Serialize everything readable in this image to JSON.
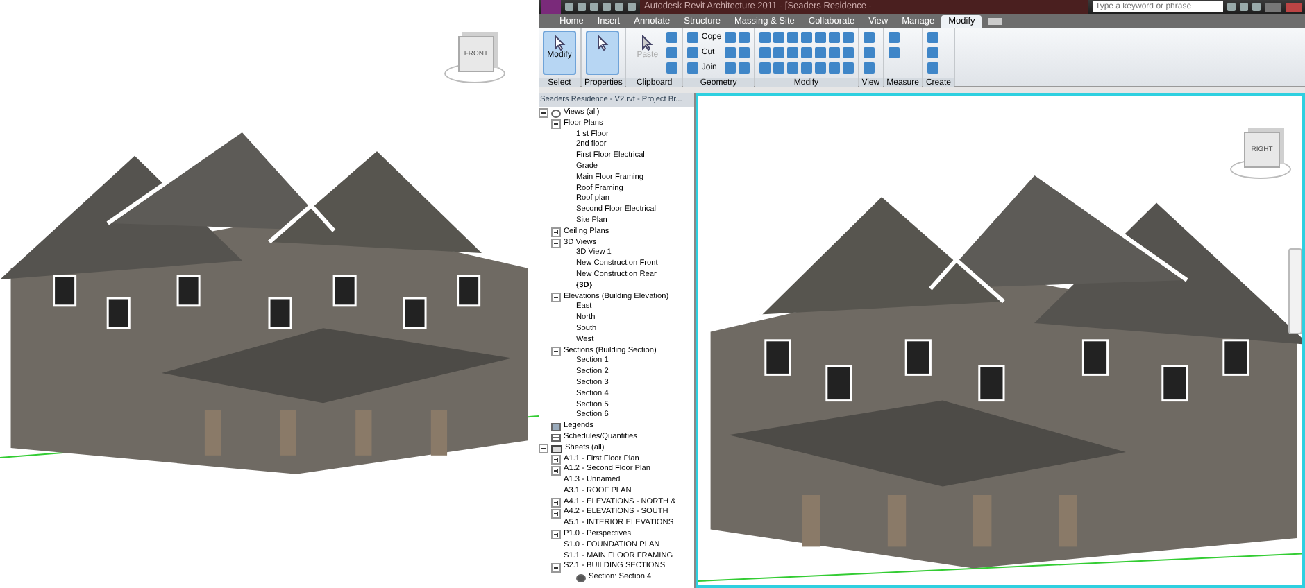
{
  "left_view": {
    "view_cube": {
      "face": "FRONT"
    }
  },
  "title_bar": {
    "title": "Autodesk Revit Architecture 2011 - [Seaders Residence -",
    "search": {
      "placeholder": "Type a keyword or phrase"
    }
  },
  "ribbon": {
    "tabs": [
      {
        "label": "Home",
        "selected": false
      },
      {
        "label": "Insert",
        "selected": false
      },
      {
        "label": "Annotate",
        "selected": false
      },
      {
        "label": "Structure",
        "selected": false
      },
      {
        "label": "Massing & Site",
        "selected": false
      },
      {
        "label": "Collaborate",
        "selected": false
      },
      {
        "label": "View",
        "selected": false
      },
      {
        "label": "Manage",
        "selected": false
      },
      {
        "label": "Modify",
        "selected": true
      }
    ],
    "panels": [
      {
        "label": "Select",
        "tools": [
          {
            "kind": "large",
            "label": "Modify",
            "active": true,
            "disabled": false
          }
        ]
      },
      {
        "label": "Properties",
        "tools": [
          {
            "kind": "large",
            "active": true,
            "disabled": false
          }
        ]
      },
      {
        "label": "Clipboard",
        "tools": [
          {
            "kind": "large",
            "label": "Paste",
            "active": false,
            "disabled": true
          },
          {
            "kind": "icon"
          },
          {
            "kind": "icon"
          },
          {
            "kind": "icon"
          }
        ]
      },
      {
        "label": "Geometry",
        "tools": [
          {
            "kind": "small",
            "label": "Cope"
          },
          {
            "kind": "small",
            "label": "Cut"
          },
          {
            "kind": "small",
            "label": "Join"
          },
          {
            "kind": "icon"
          },
          {
            "kind": "icon"
          },
          {
            "kind": "icon"
          },
          {
            "kind": "icon"
          },
          {
            "kind": "icon"
          },
          {
            "kind": "icon"
          }
        ]
      },
      {
        "label": "Modify",
        "tools": [
          {
            "kind": "icon"
          },
          {
            "kind": "icon"
          },
          {
            "kind": "icon"
          },
          {
            "kind": "icon"
          },
          {
            "kind": "icon"
          },
          {
            "kind": "icon"
          },
          {
            "kind": "icon"
          },
          {
            "kind": "icon"
          },
          {
            "kind": "icon"
          },
          {
            "kind": "icon"
          },
          {
            "kind": "icon"
          },
          {
            "kind": "icon"
          },
          {
            "kind": "icon"
          },
          {
            "kind": "icon"
          },
          {
            "kind": "icon"
          },
          {
            "kind": "icon"
          },
          {
            "kind": "icon"
          },
          {
            "kind": "icon"
          },
          {
            "kind": "icon"
          },
          {
            "kind": "icon"
          },
          {
            "kind": "icon"
          }
        ]
      },
      {
        "label": "View",
        "tools": [
          {
            "kind": "icon"
          },
          {
            "kind": "icon"
          },
          {
            "kind": "icon"
          }
        ]
      },
      {
        "label": "Measure",
        "tools": [
          {
            "kind": "icon"
          },
          {
            "kind": "icon"
          }
        ]
      },
      {
        "label": "Create",
        "tools": [
          {
            "kind": "icon"
          },
          {
            "kind": "icon"
          },
          {
            "kind": "icon"
          }
        ]
      }
    ]
  },
  "project_browser": {
    "title": "Seaders Residence - V2.rvt - Project Br...",
    "items": [
      {
        "label": "Views (all)",
        "kind": "views",
        "expanded": true,
        "selected": false,
        "children": [
          {
            "label": "Floor Plans",
            "expanded": true,
            "selected": false,
            "children": [
              {
                "label": "1 st Floor",
                "selected": false
              },
              {
                "label": "2nd floor",
                "selected": false
              },
              {
                "label": "First Floor Electrical",
                "selected": false
              },
              {
                "label": "Grade",
                "selected": false
              },
              {
                "label": "Main Floor Framing",
                "selected": false
              },
              {
                "label": "Roof Framing",
                "selected": false
              },
              {
                "label": "Roof plan",
                "selected": false
              },
              {
                "label": "Second Floor Electrical",
                "selected": false
              },
              {
                "label": "Site Plan",
                "selected": false
              }
            ]
          },
          {
            "label": "Ceiling Plans",
            "expanded": false,
            "selected": false
          },
          {
            "label": "3D Views",
            "expanded": true,
            "selected": false,
            "children": [
              {
                "label": "3D View 1",
                "selected": false
              },
              {
                "label": "New Construction Front",
                "selected": false
              },
              {
                "label": "New Construction Rear",
                "selected": false
              },
              {
                "label": "{3D}",
                "selected": true
              }
            ]
          },
          {
            "label": "Elevations (Building Elevation)",
            "expanded": true,
            "selected": false,
            "children": [
              {
                "label": "East",
                "selected": false
              },
              {
                "label": "North",
                "selected": false
              },
              {
                "label": "South",
                "selected": false
              },
              {
                "label": "West",
                "selected": false
              }
            ]
          },
          {
            "label": "Sections (Building Section)",
            "expanded": true,
            "selected": false,
            "children": [
              {
                "label": "Section 1",
                "selected": false
              },
              {
                "label": "Section 2",
                "selected": false
              },
              {
                "label": "Section 3",
                "selected": false
              },
              {
                "label": "Section 4",
                "selected": false
              },
              {
                "label": "Section 5",
                "selected": false
              },
              {
                "label": "Section 6",
                "selected": false
              }
            ]
          }
        ]
      },
      {
        "label": "Legends",
        "kind": "legend",
        "selected": false
      },
      {
        "label": "Schedules/Quantities",
        "kind": "schedule",
        "selected": false
      },
      {
        "label": "Sheets (all)",
        "kind": "sheets",
        "expanded": true,
        "selected": false,
        "children": [
          {
            "label": "A1.1 - First Floor Plan",
            "expanded": false,
            "selected": false
          },
          {
            "label": "A1.2 - Second Floor Plan",
            "expanded": false,
            "selected": false
          },
          {
            "label": "A1.3 - Unnamed",
            "selected": false
          },
          {
            "label": "A3.1 - ROOF PLAN",
            "selected": false
          },
          {
            "label": "A4.1 - ELEVATIONS - NORTH &",
            "expanded": false,
            "selected": false
          },
          {
            "label": "A4.2 - ELEVATIONS - SOUTH",
            "expanded": false,
            "selected": false
          },
          {
            "label": "A5.1 - INTERIOR ELEVATIONS",
            "selected": false
          },
          {
            "label": "P1.0 - Perspectives",
            "expanded": false,
            "selected": false
          },
          {
            "label": "S1.0 - FOUNDATION PLAN",
            "selected": false
          },
          {
            "label": "S1.1 - MAIN FLOOR FRAMING",
            "selected": false
          },
          {
            "label": "S2.1 - BUILDING SECTIONS",
            "expanded": true,
            "selected": false,
            "children": [
              {
                "label": "Section: Section 4",
                "kind": "section",
                "selected": false
              }
            ]
          }
        ]
      }
    ]
  },
  "right_view": {
    "view_cube": {
      "face": "RIGHT"
    }
  }
}
